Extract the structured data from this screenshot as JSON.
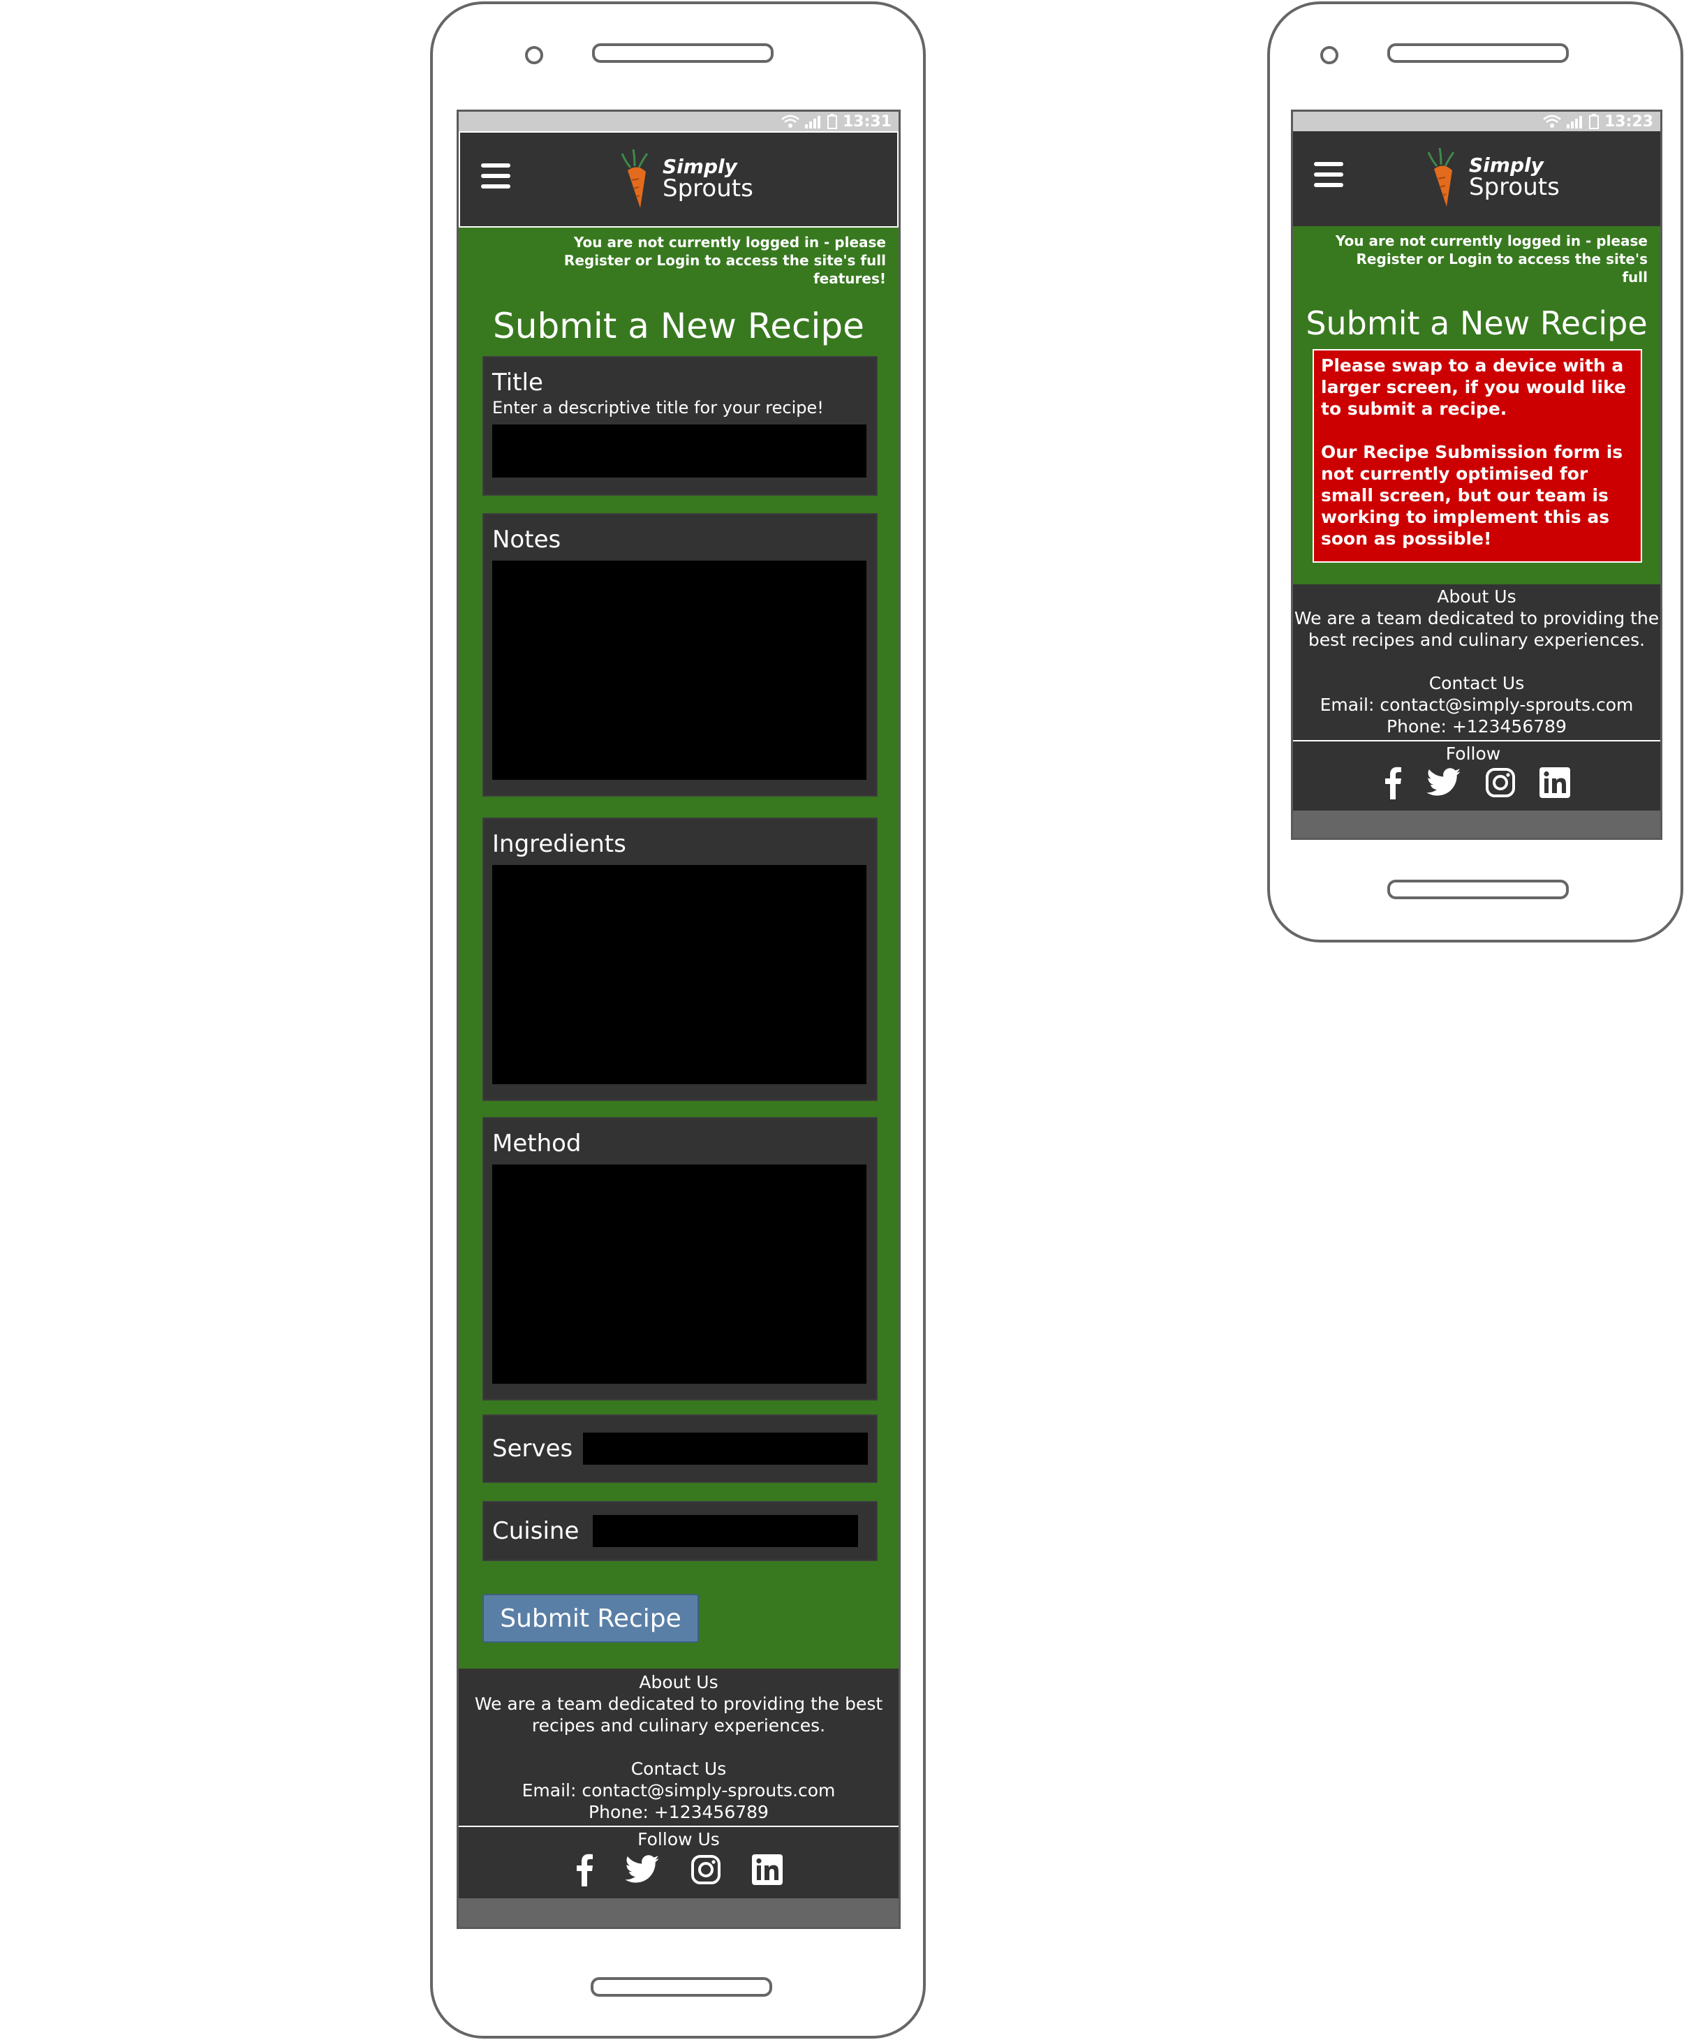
{
  "mockup_a": {
    "status": {
      "time": "13:31"
    },
    "logo": {
      "line1": "Simply",
      "line2": "Sprouts"
    },
    "notice": "You are not currently logged in - please Register or Login to access the site's full features!",
    "page_title": "Submit a New Recipe",
    "form": {
      "title_label": "Title",
      "title_help": "Enter a descriptive title for your recipe!",
      "notes_label": "Notes",
      "ingredients_label": "Ingredients",
      "method_label": "Method",
      "serves_label": "Serves",
      "cuisine_label": "Cuisine",
      "submit_label": "Submit Recipe"
    },
    "footer": {
      "about_heading": "About Us",
      "about_line1": "We are a team dedicated to providing the best",
      "about_line2": "recipes and culinary experiences.",
      "contact_heading": "Contact Us",
      "email": "Email: contact@simply-sprouts.com",
      "phone": "Phone: +123456789",
      "follow_heading": "Follow Us"
    }
  },
  "mockup_b": {
    "status": {
      "time": "13:23"
    },
    "logo": {
      "line1": "Simply",
      "line2": "Sprouts"
    },
    "notice": "You are not currently logged in - please Register or Login to access the site's full",
    "page_title": "Submit a New Recipe",
    "warning": {
      "para1": "Please swap to a device with a larger screen, if you would like to submit a recipe.",
      "para2": "Our Recipe Submission form is not currently optimised for small screen, but our team is working to implement this as soon as possible!"
    },
    "footer": {
      "about_heading": "About Us",
      "about_line1": "We are a team dedicated to providing the",
      "about_line2": "best recipes and culinary experiences.",
      "contact_heading": "Contact Us",
      "email": "Email: contact@simply-sprouts.com",
      "phone": "Phone: +123456789",
      "follow_heading": "Follow"
    }
  },
  "icons": [
    "wifi-icon",
    "signal-icon",
    "battery-icon",
    "hamburger-menu-icon",
    "carrot-logo-icon",
    "facebook-icon",
    "twitter-icon",
    "instagram-icon",
    "linkedin-icon"
  ],
  "colors": {
    "page_green": "#38791f",
    "panel_dark": "#333333",
    "warning_red": "#cc0000",
    "button_blue": "#5a7fa6"
  }
}
